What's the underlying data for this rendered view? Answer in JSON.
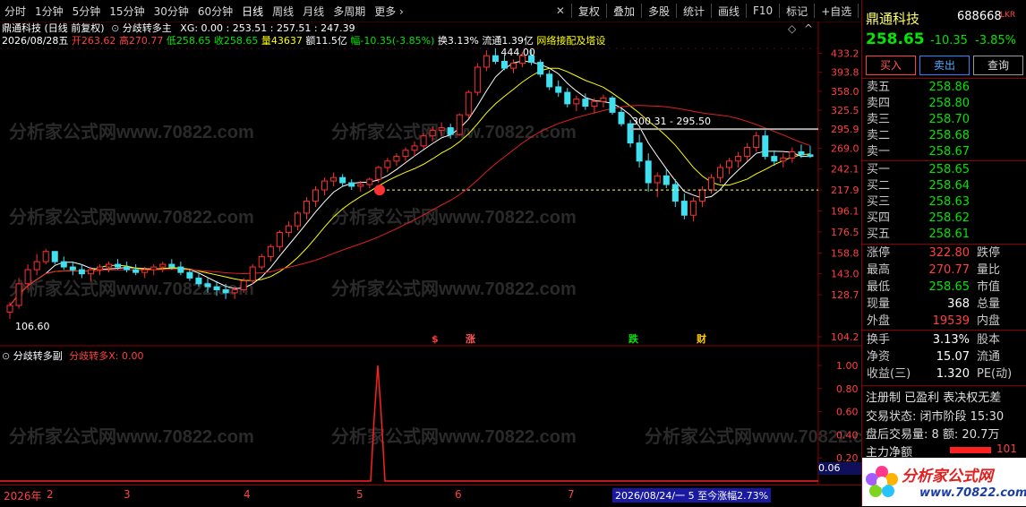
{
  "toolbar": {
    "periods": [
      "分时",
      "1分钟",
      "5分钟",
      "15分钟",
      "30分钟",
      "60分钟",
      "日线",
      "周线",
      "月线",
      "多周期",
      "更多"
    ],
    "right": [
      "复权",
      "叠加",
      "多股",
      "统计",
      "画线",
      "F10",
      "标记",
      "+自选",
      "返回"
    ]
  },
  "chart": {
    "title": "鼎通科技 (日线 前复权)",
    "indicator_name": "分歧转多主",
    "indicator_values": "XG: 0.00 : 253.51 : 257.51 : 247.39",
    "info": {
      "date": "2026/08/28五",
      "open": "开263.62",
      "high": "高270.77",
      "low": "低258.65",
      "close": "收258.65",
      "volume": "量43637",
      "amount": "额11.5亿",
      "change": "幅-10.35(-3.85%)",
      "turnover": "换3.13%",
      "float": "流通1.39亿",
      "tag": "网络接配及塔设"
    },
    "high_label": "444.00",
    "low_label": "106.60",
    "range_label": "300.31 - 295.50",
    "signals": [
      {
        "text": "$",
        "color": "#ff3b3b"
      },
      {
        "text": "涨",
        "color": "#ff5555"
      },
      {
        "text": "跌",
        "color": "#00e600"
      },
      {
        "text": "财",
        "color": "#ffcc00"
      }
    ],
    "price_axis": [
      "433.2",
      "393.8",
      "358.0",
      "325.5",
      "295.9",
      "269.0",
      "242.1",
      "217.9",
      "196.1",
      "176.5",
      "158.8",
      "143.0",
      "128.7",
      "104.2"
    ],
    "sub_title": "分歧转多副",
    "sub_value": "分歧转多X: 0.00",
    "sub_axis": [
      "1.00",
      "0.80",
      "0.60",
      "0.40",
      "0.20"
    ],
    "sub_extra": "0.06",
    "time_axis": [
      "2026年",
      "2",
      "3",
      "4",
      "5",
      "6",
      "7"
    ],
    "footer_stat": "2026/08/24/一 5 至今涨幅2.73%",
    "watermark": "分析家公式网www.70822.com"
  },
  "chart_data": {
    "type": "candlestick",
    "series_name": "鼎通科技",
    "ylim": [
      104.2,
      444.0
    ],
    "log_scale": true,
    "candles": [
      [
        118,
        124,
        114,
        122
      ],
      [
        122,
        140,
        120,
        136
      ],
      [
        136,
        150,
        132,
        146
      ],
      [
        146,
        158,
        142,
        152
      ],
      [
        152,
        162,
        150,
        160
      ],
      [
        160,
        158,
        150,
        152
      ],
      [
        152,
        156,
        146,
        148
      ],
      [
        148,
        152,
        142,
        146
      ],
      [
        146,
        150,
        140,
        143
      ],
      [
        143,
        148,
        138,
        146
      ],
      [
        146,
        150,
        142,
        148
      ],
      [
        148,
        152,
        144,
        150
      ],
      [
        150,
        154,
        146,
        148
      ],
      [
        148,
        152,
        144,
        146
      ],
      [
        146,
        150,
        142,
        144
      ],
      [
        144,
        148,
        140,
        146
      ],
      [
        146,
        150,
        142,
        148
      ],
      [
        148,
        152,
        144,
        150
      ],
      [
        150,
        154,
        146,
        148
      ],
      [
        148,
        152,
        142,
        144
      ],
      [
        144,
        146,
        138,
        140
      ],
      [
        140,
        144,
        134,
        136
      ],
      [
        136,
        140,
        130,
        134
      ],
      [
        134,
        138,
        128,
        132
      ],
      [
        132,
        136,
        126,
        130
      ],
      [
        130,
        134,
        126,
        132
      ],
      [
        132,
        140,
        130,
        138
      ],
      [
        138,
        150,
        136,
        148
      ],
      [
        148,
        158,
        146,
        156
      ],
      [
        156,
        166,
        152,
        164
      ],
      [
        164,
        178,
        160,
        176
      ],
      [
        176,
        186,
        172,
        182
      ],
      [
        182,
        196,
        178,
        194
      ],
      [
        194,
        210,
        188,
        206
      ],
      [
        206,
        222,
        200,
        218
      ],
      [
        218,
        232,
        212,
        228
      ],
      [
        228,
        238,
        222,
        232
      ],
      [
        232,
        236,
        222,
        226
      ],
      [
        226,
        230,
        218,
        222
      ],
      [
        222,
        228,
        216,
        224
      ],
      [
        224,
        232,
        220,
        230
      ],
      [
        230,
        246,
        226,
        244
      ],
      [
        244,
        256,
        238,
        252
      ],
      [
        252,
        262,
        246,
        258
      ],
      [
        258,
        270,
        252,
        266
      ],
      [
        266,
        278,
        258,
        272
      ],
      [
        272,
        290,
        268,
        286
      ],
      [
        286,
        300,
        278,
        294
      ],
      [
        294,
        306,
        286,
        298
      ],
      [
        298,
        304,
        282,
        288
      ],
      [
        288,
        320,
        286,
        318
      ],
      [
        318,
        360,
        312,
        356
      ],
      [
        356,
        412,
        350,
        404
      ],
      [
        404,
        440,
        396,
        428
      ],
      [
        428,
        444,
        410,
        416
      ],
      [
        416,
        430,
        398,
        402
      ],
      [
        402,
        420,
        392,
        412
      ],
      [
        412,
        436,
        404,
        428
      ],
      [
        428,
        440,
        408,
        414
      ],
      [
        414,
        420,
        384,
        390
      ],
      [
        390,
        398,
        360,
        366
      ],
      [
        366,
        378,
        348,
        356
      ],
      [
        356,
        364,
        330,
        336
      ],
      [
        336,
        350,
        324,
        344
      ],
      [
        344,
        354,
        326,
        332
      ],
      [
        332,
        346,
        320,
        340
      ],
      [
        340,
        352,
        330,
        346
      ],
      [
        346,
        350,
        318,
        322
      ],
      [
        322,
        328,
        300,
        304
      ],
      [
        304,
        310,
        270,
        276
      ],
      [
        276,
        288,
        244,
        252
      ],
      [
        252,
        262,
        216,
        226
      ],
      [
        226,
        238,
        210,
        234
      ],
      [
        234,
        242,
        220,
        224
      ],
      [
        224,
        230,
        200,
        206
      ],
      [
        206,
        214,
        188,
        192
      ],
      [
        192,
        210,
        186,
        206
      ],
      [
        206,
        222,
        200,
        218
      ],
      [
        218,
        236,
        214,
        232
      ],
      [
        232,
        248,
        226,
        244
      ],
      [
        244,
        256,
        236,
        252
      ],
      [
        252,
        264,
        244,
        258
      ],
      [
        258,
        276,
        252,
        270
      ],
      [
        270,
        292,
        264,
        286
      ],
      [
        286,
        294,
        254,
        258
      ],
      [
        258,
        266,
        246,
        252
      ],
      [
        252,
        262,
        244,
        256
      ],
      [
        256,
        270,
        250,
        264
      ],
      [
        264,
        274,
        256,
        260
      ],
      [
        260,
        272,
        256,
        258
      ]
    ]
  },
  "panel": {
    "name": "鼎通科技",
    "code": "688668",
    "badge": "LKR",
    "price": "258.65",
    "change": "-10.35",
    "pct": "-3.85%",
    "buttons": [
      "买入",
      "卖出",
      "查询"
    ],
    "asks": [
      {
        "label": "卖五",
        "price": "258.86"
      },
      {
        "label": "卖四",
        "price": "258.80"
      },
      {
        "label": "卖三",
        "price": "258.70"
      },
      {
        "label": "卖二",
        "price": "258.68"
      },
      {
        "label": "卖一",
        "price": "258.67"
      }
    ],
    "bids": [
      {
        "label": "买一",
        "price": "258.65"
      },
      {
        "label": "买二",
        "price": "258.64"
      },
      {
        "label": "买三",
        "price": "258.63"
      },
      {
        "label": "买四",
        "price": "258.62"
      },
      {
        "label": "买五",
        "price": "258.61"
      }
    ],
    "stats": [
      {
        "label": "涨停",
        "value": "322.80",
        "label2": "跌停",
        "color": "#ff4040"
      },
      {
        "label": "最高",
        "value": "270.77",
        "label2": "量比",
        "color": "#ff4040"
      },
      {
        "label": "最低",
        "value": "258.65",
        "label2": "市值",
        "color": "#00e600"
      },
      {
        "label": "现量",
        "value": "368",
        "label2": "总量",
        "color": "#ffffff"
      },
      {
        "label": "外盘",
        "value": "19539",
        "label2": "内盘",
        "color": "#ff4040"
      }
    ],
    "fin": [
      {
        "label": "换手",
        "value": "3.13%",
        "label2": "股本"
      },
      {
        "label": "净资",
        "value": "15.07",
        "label2": "流通"
      },
      {
        "label": "收益(三)",
        "value": "1.320",
        "label2": "PE(动)"
      }
    ],
    "reg": "注册制 已盈利 表决权无差",
    "trade_status": "交易状态: 闭市阶段 15:30",
    "after_hours": "盘后交易量: 8 额: 20.7万",
    "main_flow_label": "主力净额",
    "main_flow_value": "101",
    "logo_text": "分析家公式网",
    "logo_url": "www.70822.com"
  }
}
